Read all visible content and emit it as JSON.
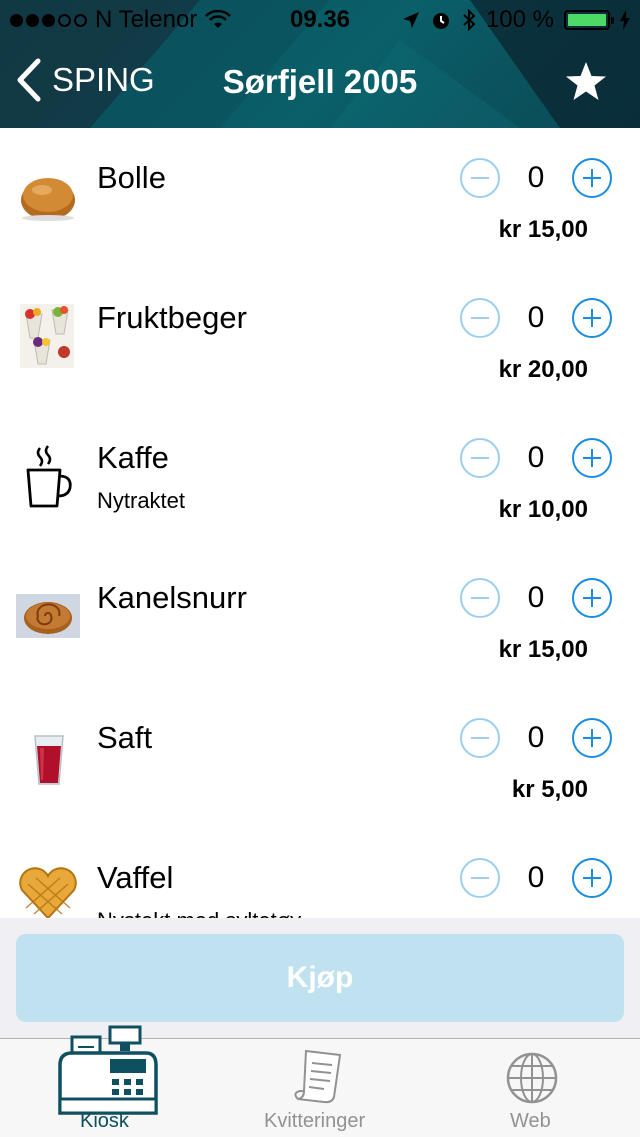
{
  "status_bar": {
    "carrier": "N Telenor",
    "time": "09.36",
    "battery": "100 %",
    "signal_dots_filled": 3,
    "signal_dots_total": 5
  },
  "nav": {
    "back_label": "SPING",
    "title": "Sørfjell 2005",
    "star_icon": "star-icon"
  },
  "items": [
    {
      "name": "Bolle",
      "description": "",
      "quantity": "0",
      "price": "kr 15,00",
      "icon": "bun-icon"
    },
    {
      "name": "Fruktbeger",
      "description": "",
      "quantity": "0",
      "price": "kr 20,00",
      "icon": "fruit-cup-icon"
    },
    {
      "name": "Kaffe",
      "description": "Nytraktet",
      "quantity": "0",
      "price": "kr 10,00",
      "icon": "coffee-cup-icon"
    },
    {
      "name": "Kanelsnurr",
      "description": "",
      "quantity": "0",
      "price": "kr 15,00",
      "icon": "cinnamon-roll-icon"
    },
    {
      "name": "Saft",
      "description": "",
      "quantity": "0",
      "price": "kr 5,00",
      "icon": "juice-glass-icon"
    },
    {
      "name": "Vaffel",
      "description": "Nystekt med syltetøy",
      "quantity": "0",
      "price": "",
      "icon": "waffle-icon"
    }
  ],
  "buy_button": {
    "label": "Kjøp"
  },
  "tabs": [
    {
      "label": "Kiosk",
      "icon": "cash-register-icon",
      "active": true
    },
    {
      "label": "Kvitteringer",
      "icon": "receipt-icon",
      "active": false
    },
    {
      "label": "Web",
      "icon": "globe-icon",
      "active": false
    }
  ],
  "colors": {
    "header_dark": "#0b4e58",
    "accent_blue": "#1a8ce0",
    "disabled_blue": "#9ccfee",
    "buy_button_bg": "#c0e1ef",
    "tab_active": "#0e4f60",
    "battery_green": "#4cd964"
  }
}
